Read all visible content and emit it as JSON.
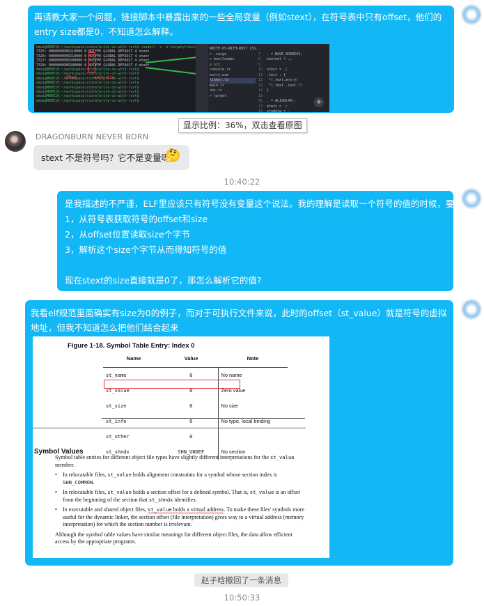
{
  "messages": [
    {
      "sender": "me",
      "text": "再请教大家一个问题，链接脚本中暴露出来的一些全局变量（例如stext），在符号表中只有offset，他们的entry size都是0，不知道怎么解释。",
      "image": {
        "terminal_lines": [
          "dmai@MODE10:~/workspace/rcore/write-os-with-rust$ readelf -s -d target/riscv64gc-unknown-none-elf/debug/os | grep text",
          "  7325: 0000000080210000     0 NOTYPE  GLOBAL DEFAULT    4 stext",
          "  7326: 0000000080210000     0 NOTYPE  GLOBAL DEFAULT    4 stext",
          "  7327: 0000000080200000     0 NOTYPE  GLOBAL DEFAULT    4 stext",
          "  7328: 0000000080200000     0 NOTYPE  GLOBAL DEFAULT    4 etext",
          "dmai@MODE10:~/workspace/rcore/write-os-with-rust$",
          "dmai@MODE10:~/workspace/rcore/write-os-with-rust$",
          "dmai@MODE10:~/workspace/rcore/write-os-with-rust$",
          "dmai@MODE10:~/workspace/rcore/write-os-with-rust$",
          "dmai@MODE10:~/workspace/rcore/write-os-with-rust$",
          "dmai@MODE10:~/workspace/rcore/write-os-with-rust$",
          "dmai@MODE10:~/workspace/rcore/write-os-with-rust$",
          "dmai@MODE10:~/workspace/rcore/write-os-with-rust$"
        ],
        "offset_note": "offset",
        "size_note": "entry size",
        "tree_items": [
          "WRITE-OS-WITH-RUST [SS...",
          "> .cargo",
          "> bootloader",
          "v src",
          "  console.rs",
          "  entry.asm",
          "  linker.ld",
          "  main.rs",
          "  sbi.rs",
          "> target"
        ],
        "code_lines": [
          "",
          ". = BASE_ADDRESS;",
          "skernel = .;",
          "",
          "stext = .;",
          ".text : {",
          "  *(.text.entry)",
          "  *(.text .text.*)",
          "}",
          "",
          ". = ALIGN(4K);",
          "etext = .;",
          "srodata = ."
        ],
        "line_numbers": [
          "",
          "7",
          "8",
          "9",
          "10",
          "11",
          "12",
          "13",
          "14",
          "15",
          "16",
          "17",
          "18"
        ],
        "fab_symbol": "+"
      }
    }
  ],
  "ratio_tip": "显示比例：36%，双击查看原图",
  "other_user": {
    "name": "DRAGONBURN NEVER BORN",
    "message": "stext 不是符号吗？它不是变量呀",
    "emoji": "🤔"
  },
  "time1": "10:40:22",
  "reply1": {
    "line1": "是我描述的不严谨，ELF里应该只有符号没有变量这个说法。我的理解是读取一个符号的值的时候，要:",
    "step1": "1，从符号表获取符号的offset和size",
    "step2": "2，从offset位置读取size个字节",
    "step3": "3，解析这个size个字节从而得知符号的值",
    "question": "现在stext的size直接就是0了，那怎么解析它的值?"
  },
  "reply2": {
    "text": "我看elf规范里面确实有size为0的例子，而对于可执行文件来说，此时的offset（st_value）就是符号的虚拟地址，但我不知道怎么把他们结合起来",
    "doc": {
      "figure_title": "Figure 1-18.  Symbol Table Entry: Index 0",
      "headers": [
        "Name",
        "Value",
        "Note"
      ],
      "rows": [
        [
          "st_name",
          "0",
          "No name"
        ],
        [
          "st_value",
          "0",
          "Zero value"
        ],
        [
          "st_size",
          "0",
          "No size"
        ],
        [
          "st_info",
          "0",
          "No type, local binding"
        ],
        [
          "st_other",
          "0",
          ""
        ],
        [
          "st_shndx",
          "SHN_UNDEF",
          "No section"
        ]
      ],
      "section_title": "Symbol Values",
      "intro_1": "Symbol table entries for different object file types have slightly different interpretations for the ",
      "intro_code": "st_value",
      "intro_2": " member.",
      "b1_1": "In relocatable files, ",
      "b1_code1": "st_value",
      "b1_2": " holds alignment constraints for a symbol whose section index is ",
      "b1_code2": "SHN_COMMON",
      "b1_3": ".",
      "b2_1": "In relocatable files, ",
      "b2_code1": "st_value",
      "b2_2": " holds a section offset for a defined symbol. That is, ",
      "b2_code2": "st_value",
      "b2_3": " is an offset from the beginning of the section that ",
      "b2_code3": "st_shndx",
      "b2_4": " identifies.",
      "b3_1": "In executable and shared object files, ",
      "b3_code": "st_value",
      "b3_ul": " holds a virtual address",
      "b3_2": ". To make these files' symbols more useful for the dynamic linker, the section offset (file interpretation) gives way to a virtual address (memory interpretation) for which the section number is irrelevant.",
      "closing": "Although the symbol table values have similar meanings for different object files, the data allow efficient access by the appropriate programs."
    }
  },
  "recall_notice": "赵子晗撤回了一条消息",
  "time2": "10:50:33",
  "colors": {
    "bubble": "#12b7f5",
    "highlight": "#e5383b"
  }
}
